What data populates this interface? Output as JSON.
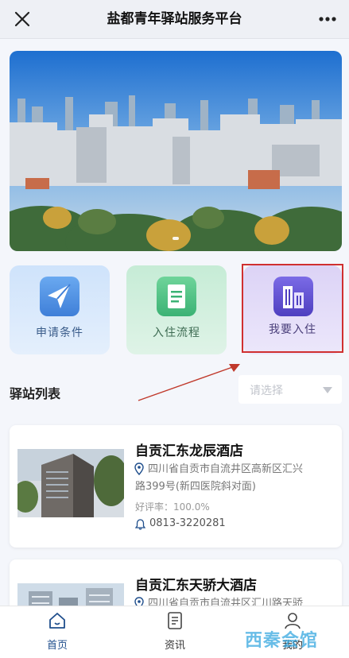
{
  "header": {
    "title": "盐都青年驿站服务平台"
  },
  "features": [
    {
      "label": "申请条件",
      "icon": "paper-plane-icon"
    },
    {
      "label": "入住流程",
      "icon": "document-icon"
    },
    {
      "label": "我要入住",
      "icon": "building-icon"
    }
  ],
  "station_list": {
    "title": "驿站列表",
    "select_placeholder": "请选择",
    "items": [
      {
        "name": "自贡汇东龙辰酒店",
        "address_line1": "四川省自贡市自流井区高新区汇兴",
        "address_line2": "路399号(新四医院斜对面)",
        "rating": "好评率：100.0%",
        "phone": "0813-3220281"
      },
      {
        "name": "自贡汇东天骄大酒店",
        "address_line1": "四川省自贡市自流井区汇川路天骄"
      }
    ]
  },
  "tabbar": {
    "items": [
      {
        "label": "首页",
        "icon": "home-icon",
        "active": true
      },
      {
        "label": "资讯",
        "icon": "news-icon",
        "active": false
      },
      {
        "label": "我的",
        "icon": "user-icon",
        "active": false
      }
    ]
  },
  "watermark": "西秦会馆",
  "colors": {
    "accent": "#1f4e8c",
    "highlight": "#d03030"
  }
}
